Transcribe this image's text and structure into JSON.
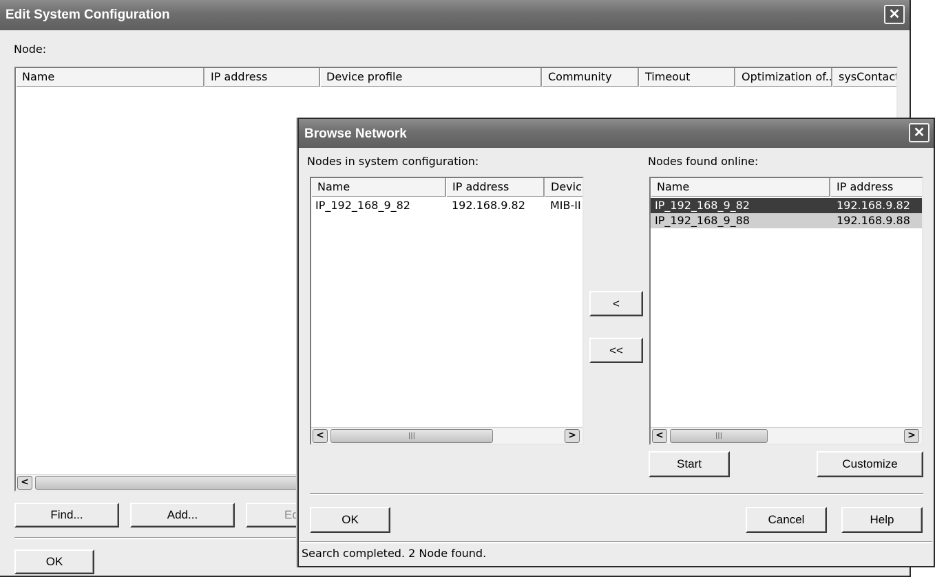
{
  "main_window": {
    "title": "Edit System Configuration",
    "node_label": "Node:",
    "columns": [
      "Name",
      "IP address",
      "Device profile",
      "Community",
      "Timeout",
      "Optimization of...",
      "sysContact"
    ],
    "buttons": {
      "find": "Find...",
      "add": "Add...",
      "edit": "Ed",
      "ok": "OK"
    }
  },
  "dialog": {
    "title": "Browse Network",
    "left_label": "Nodes in system configuration:",
    "right_label": "Nodes found online:",
    "left_columns": [
      "Name",
      "IP address",
      "Devic"
    ],
    "left_rows": [
      {
        "name": "IP_192_168_9_82",
        "ip": "192.168.9.82",
        "device": "MIB-II,"
      }
    ],
    "right_columns": [
      "Name",
      "IP address"
    ],
    "right_rows": [
      {
        "name": "IP_192_168_9_82",
        "ip": "192.168.9.82",
        "state": "selected"
      },
      {
        "name": "IP_192_168_9_88",
        "ip": "192.168.9.88",
        "state": "selected-inactive"
      }
    ],
    "move_one_label": "<",
    "move_all_label": "<<",
    "start_label": "Start",
    "customize_label": "Customize",
    "ok_label": "OK",
    "cancel_label": "Cancel",
    "help_label": "Help",
    "status": "Search completed. 2 Node found.",
    "scroll_left_glyph": "<",
    "scroll_right_glyph": ">",
    "thumb_grip": "|||"
  },
  "close_glyph": "✕",
  "colors": {
    "titlebar": "#6e6e6e",
    "selected_row": "#3c3c3c",
    "inactive_selection": "#cfcfcf",
    "window_bg": "#ececec"
  }
}
